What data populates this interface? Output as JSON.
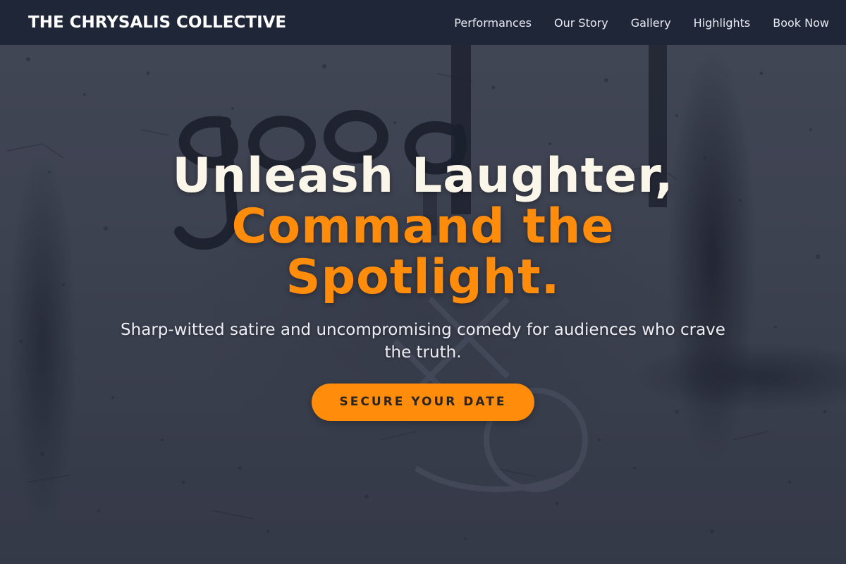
{
  "brand": {
    "name": "THE CHRYSALIS COLLECTIVE"
  },
  "nav": {
    "items": [
      {
        "label": "Performances"
      },
      {
        "label": "Our Story"
      },
      {
        "label": "Gallery"
      },
      {
        "label": "Highlights"
      },
      {
        "label": "Book Now"
      }
    ]
  },
  "hero": {
    "headline_line1": "Unleash Laughter,",
    "headline_accent": "Command the Spotlight.",
    "subheadline": "Sharp-witted satire and uncompromising comedy for audiences who crave the truth.",
    "cta_label": "SECURE YOUR DATE",
    "background_graffiti": "good",
    "background_watermark": "butt        com"
  },
  "colors": {
    "nav_background": "#1f2638",
    "accent": "#ff8c0a",
    "headline_text": "#fbf6ea",
    "hero_background": "#454b5a"
  }
}
